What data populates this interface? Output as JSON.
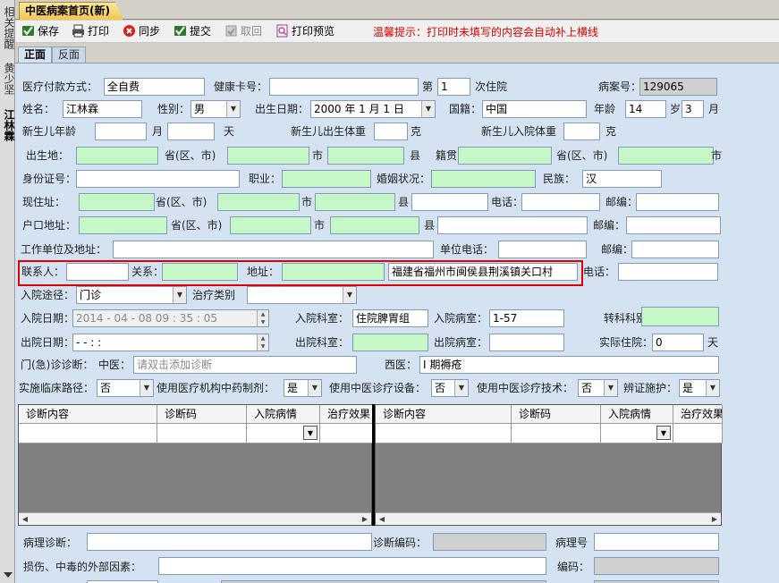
{
  "leftbar": {
    "items": [
      {
        "label": "相关提醒"
      },
      {
        "label": "黄少坚"
      },
      {
        "label": "江林霖"
      }
    ]
  },
  "window": {
    "tab_title": "中医病案首页(新)"
  },
  "toolbar": {
    "save": "保存",
    "print": "打印",
    "sync": "同步",
    "submit": "提交",
    "fetch": "取回",
    "print_preview": "打印预览",
    "tip": "温馨提示：打印时未填写的内容会自动补上横线"
  },
  "subtabs": {
    "front": "正面",
    "back": "反面"
  },
  "form": {
    "payment_label": "医疗付款方式：",
    "payment_value": "全自费",
    "health_card_label": "健康卡号：",
    "health_card_value": "",
    "visit_prefix": "第",
    "visit_value": "1",
    "visit_suffix": "次住院",
    "case_no_label": "病案号：",
    "case_no_value": "129065",
    "name_label": "姓名：",
    "name_value": "江林霖",
    "sex_label": "性别：",
    "sex_value": "男",
    "birth_label": "出生日期：",
    "birth_value": "2000 年 1 月 1 日",
    "nationality_label": "国籍：",
    "nationality_value": "中国",
    "age_label": "年龄",
    "age_years": "14",
    "age_years_unit": "岁",
    "age_months": "3",
    "age_months_unit": "月",
    "newborn_age_label": "新生儿年龄",
    "newborn_month_unit": "月",
    "newborn_day_unit": "天",
    "newborn_birth_weight_label": "新生儿出生体重",
    "weight_unit_1": "克",
    "newborn_admit_weight_label": "新生儿入院体重",
    "weight_unit_2": "克",
    "birthplace_label": "出生地：",
    "province_label": "省(区、市)",
    "city_label": "市",
    "county_label": "县",
    "native_label": "籍贯",
    "native_province_label": "省(区、市)",
    "native_city_label": "市",
    "id_label": "身份证号：",
    "occupation_label": "职业：",
    "marital_label": "婚姻状况：",
    "ethnic_label": "民族：",
    "ethnic_value": "汉",
    "current_addr_label": "现住址：",
    "cur_province_label": "省(区、市)",
    "cur_city_label": "市",
    "cur_county_label": "县",
    "cur_phone_label": "电话：",
    "cur_postcode_label": "邮编：",
    "hukou_label": "户口地址：",
    "hk_province_label": "省(区、市)",
    "hk_city_label": "市",
    "hk_county_label": "县",
    "hk_postcode_label": "邮编：",
    "work_label": "工作单位及地址：",
    "work_phone_label": "单位电话：",
    "work_postcode_label": "邮编：",
    "contact_label": "联系人：",
    "relation_label": "关系：",
    "contact_addr_label": "地址：",
    "contact_addr_value": "福建省福州市闽侯县荆溪镇关口村",
    "contact_phone_label": "电话：",
    "admit_route_label": "入院途径：",
    "admit_route_value": "门诊",
    "treat_type_label": "治疗类别",
    "admit_date_label": "入院日期：",
    "admit_date_value": "2014 - 04 - 08   09 : 35 : 05",
    "admit_dept_label": "入院科室：",
    "admit_dept_value": "住院脾胃组",
    "admit_ward_label": "入院病室：",
    "admit_ward_value": "1-57",
    "transfer_label": "转科科别：",
    "discharge_date_label": "出院日期：",
    "discharge_date_value": "  -   -       :   :",
    "discharge_dept_label": "出院科室：",
    "discharge_ward_label": "出院病室：",
    "actual_days_label": "实际住院：",
    "actual_days_value": "0",
    "actual_days_unit": "天",
    "outpatient_diag_label": "门(急)诊诊断：",
    "tcm_label": "中医：",
    "tcm_placeholder": "请双击添加诊断",
    "western_label": "西医：",
    "western_value": "I 期褥疮",
    "pathway_label": "实施临床路径：",
    "pathway_value": "否",
    "tcm_prep_label": "使用医疗机构中药制剂：",
    "tcm_prep_value": "是",
    "tcm_equip_label": "使用中医诊疗设备：",
    "tcm_equip_value": "否",
    "tcm_tech_label": "使用中医诊疗技术：",
    "tcm_tech_value": "否",
    "syndrome_label": "辨证施护：",
    "syndrome_value": "是",
    "pathology_label": "病理诊断：",
    "diag_code_label": "诊断编码：",
    "pathology_no_label": "病理号",
    "injury_label": "损伤、中毒的外部因素：",
    "code_label": "编码："
  },
  "diag_table": {
    "left_cols": [
      "诊断内容",
      "诊断码",
      "入院病情",
      "治疗效果"
    ],
    "right_cols": [
      "诊断内容",
      "诊断码",
      "入院病情",
      "治疗效果"
    ]
  }
}
